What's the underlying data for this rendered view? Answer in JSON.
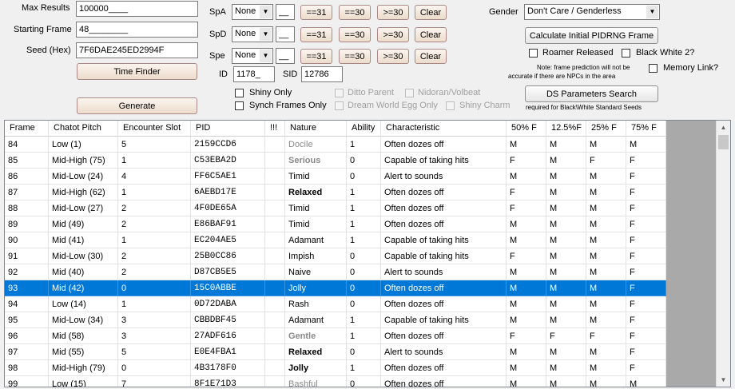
{
  "form": {
    "max_results_label": "Max Results",
    "max_results_value": "100000____",
    "starting_frame_label": "Starting Frame",
    "starting_frame_value": "48________",
    "seed_label": "Seed (Hex)",
    "seed_value": "7F6DAE245ED2994F",
    "time_finder": "Time Finder",
    "generate": "Generate"
  },
  "ivs": {
    "spa_label": "SpA",
    "spd_label": "SpD",
    "spe_label": "Spe",
    "compare_value": "None",
    "iv_value": "__",
    "eq31": "==31",
    "eq30": "==30",
    "ge30": ">=30",
    "clear": "Clear"
  },
  "ids": {
    "id_label": "ID",
    "id_value": "1178_",
    "sid_label": "SID",
    "sid_value": "12786"
  },
  "options": {
    "shiny_only": "Shiny Only",
    "synch_frames_only": "Synch Frames Only",
    "ditto_parent": "Ditto Parent",
    "nidoran_volbeat": "Nidoran/Volbeat",
    "dream_world_egg_only": "Dream World Egg Only",
    "shiny_charm": "Shiny Charm"
  },
  "right": {
    "gender_label": "Gender",
    "gender_value": "Don't Care / Genderless",
    "calc_pidrng": "Calculate Initial PIDRNG Frame",
    "roamer_released": "Roamer Released",
    "black_white_2": "Black White 2?",
    "note_line1": "Note: frame prediction will not be",
    "note_line2": "accurate if there are NPCs in the area",
    "memory_link": "Memory Link?",
    "ds_params": "DS Parameters Search",
    "ds_note": "required for Black\\White Standard Seeds"
  },
  "table": {
    "headers": [
      "Frame",
      "Chatot Pitch",
      "Encounter Slot",
      "PID",
      "!!!",
      "Nature",
      "Ability",
      "Characteristic",
      "50% F",
      "12.5%F",
      "25% F",
      "75% F"
    ],
    "rows": [
      [
        "84",
        "Low (1)",
        "5",
        "2159CCD6",
        "",
        "Docile",
        "1",
        "Often dozes off",
        "M",
        "M",
        "M",
        "M"
      ],
      [
        "85",
        "Mid-High (75)",
        "1",
        "C53EBA2D",
        "",
        "Serious",
        "0",
        "Capable of taking hits",
        "F",
        "M",
        "F",
        "F"
      ],
      [
        "86",
        "Mid-Low (24)",
        "4",
        "FF6C5AE1",
        "",
        "Timid",
        "0",
        "Alert to sounds",
        "M",
        "M",
        "M",
        "F"
      ],
      [
        "87",
        "Mid-High (62)",
        "1",
        "6AEBD17E",
        "",
        "Relaxed",
        "1",
        "Often dozes off",
        "F",
        "M",
        "M",
        "F"
      ],
      [
        "88",
        "Mid-Low (27)",
        "2",
        "4F0DE65A",
        "",
        "Timid",
        "1",
        "Often dozes off",
        "F",
        "M",
        "M",
        "F"
      ],
      [
        "89",
        "Mid (49)",
        "2",
        "E86BAF91",
        "",
        "Timid",
        "1",
        "Often dozes off",
        "M",
        "M",
        "M",
        "F"
      ],
      [
        "90",
        "Mid (41)",
        "1",
        "EC204AE5",
        "",
        "Adamant",
        "1",
        "Capable of taking hits",
        "M",
        "M",
        "M",
        "F"
      ],
      [
        "91",
        "Mid-Low (30)",
        "2",
        "25B0CC86",
        "",
        "Impish",
        "0",
        "Capable of taking hits",
        "F",
        "M",
        "M",
        "F"
      ],
      [
        "92",
        "Mid (40)",
        "2",
        "D87CB5E5",
        "",
        "Naive",
        "0",
        "Alert to sounds",
        "M",
        "M",
        "M",
        "F"
      ],
      [
        "93",
        "Mid (42)",
        "0",
        "15C0ABBE",
        "",
        "Jolly",
        "0",
        "Often dozes off",
        "M",
        "M",
        "M",
        "F"
      ],
      [
        "94",
        "Low (14)",
        "1",
        "0D72DABA",
        "",
        "Rash",
        "0",
        "Often dozes off",
        "M",
        "M",
        "M",
        "F"
      ],
      [
        "95",
        "Mid-Low (34)",
        "3",
        "CBBDBF45",
        "",
        "Adamant",
        "1",
        "Capable of taking hits",
        "M",
        "M",
        "M",
        "F"
      ],
      [
        "96",
        "Mid (58)",
        "3",
        "27ADF616",
        "",
        "Gentle",
        "1",
        "Often dozes off",
        "F",
        "F",
        "F",
        "F"
      ],
      [
        "97",
        "Mid (55)",
        "5",
        "E0E4FBA1",
        "",
        "Relaxed",
        "0",
        "Alert to sounds",
        "M",
        "M",
        "M",
        "F"
      ],
      [
        "98",
        "Mid-High (79)",
        "0",
        "4B3178F0",
        "",
        "Jolly",
        "1",
        "Often dozes off",
        "M",
        "M",
        "M",
        "F"
      ],
      [
        "99",
        "Low (15)",
        "7",
        "8F1E71D3",
        "",
        "Bashful",
        "0",
        "Often dozes off",
        "M",
        "M",
        "M",
        "M"
      ]
    ],
    "nature_styles": [
      "gray",
      "bold-gray",
      "normal",
      "bold",
      "normal",
      "normal",
      "normal",
      "normal",
      "normal",
      "normal",
      "normal",
      "normal",
      "bold-gray",
      "bold",
      "bold",
      "gray"
    ],
    "selected_row": 9
  },
  "colors": {
    "selection": "#0078d7",
    "button_warm": "#ecdccb"
  }
}
